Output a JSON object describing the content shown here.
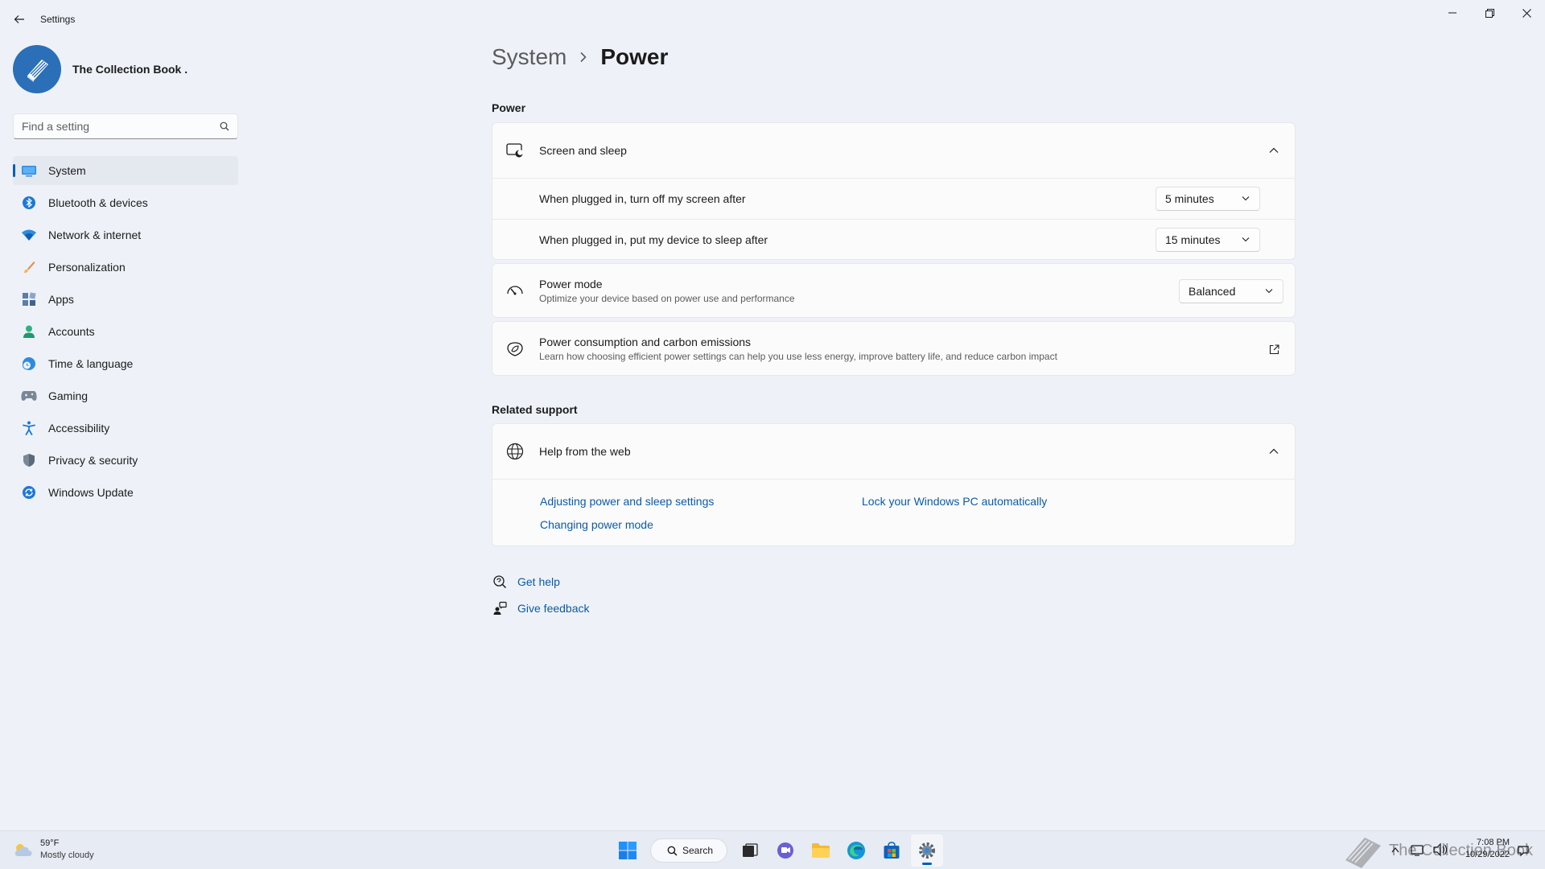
{
  "window": {
    "title": "Settings"
  },
  "profile": {
    "name": "The Collection Book ."
  },
  "search": {
    "placeholder": "Find a setting"
  },
  "sidebar": {
    "items": [
      {
        "label": "System",
        "icon": "monitor-icon",
        "active": true
      },
      {
        "label": "Bluetooth & devices",
        "icon": "bluetooth-icon"
      },
      {
        "label": "Network & internet",
        "icon": "wifi-icon"
      },
      {
        "label": "Personalization",
        "icon": "brush-icon"
      },
      {
        "label": "Apps",
        "icon": "apps-icon"
      },
      {
        "label": "Accounts",
        "icon": "person-icon"
      },
      {
        "label": "Time & language",
        "icon": "globe-clock-icon"
      },
      {
        "label": "Gaming",
        "icon": "gamepad-icon"
      },
      {
        "label": "Accessibility",
        "icon": "accessibility-icon"
      },
      {
        "label": "Privacy & security",
        "icon": "shield-icon"
      },
      {
        "label": "Windows Update",
        "icon": "update-icon"
      }
    ]
  },
  "breadcrumb": {
    "parent": "System",
    "current": "Power"
  },
  "power": {
    "section_title": "Power",
    "screen_sleep": {
      "label": "Screen and sleep",
      "screen_off": {
        "label": "When plugged in, turn off my screen after",
        "value": "5 minutes"
      },
      "sleep": {
        "label": "When plugged in, put my device to sleep after",
        "value": "15 minutes"
      }
    },
    "power_mode": {
      "label": "Power mode",
      "description": "Optimize your device based on power use and performance",
      "value": "Balanced"
    },
    "consumption": {
      "label": "Power consumption and carbon emissions",
      "description": "Learn how choosing efficient power settings can help you use less energy, improve battery life, and reduce carbon impact"
    }
  },
  "related": {
    "section_title": "Related support",
    "help_web": {
      "label": "Help from the web",
      "links": [
        "Adjusting power and sleep settings",
        "Lock your Windows PC automatically",
        "Changing power mode"
      ]
    }
  },
  "footer": {
    "get_help": "Get help",
    "give_feedback": "Give feedback"
  },
  "taskbar": {
    "weather_temp": "59°F",
    "weather_cond": "Mostly cloudy",
    "search_label": "Search",
    "time": "7:08 PM",
    "date": "10/29/2022",
    "watermark": "The Collection Book"
  },
  "colors": {
    "accent": "#005fb8",
    "link": "#0b5aa8",
    "background": "#eef2f8"
  }
}
